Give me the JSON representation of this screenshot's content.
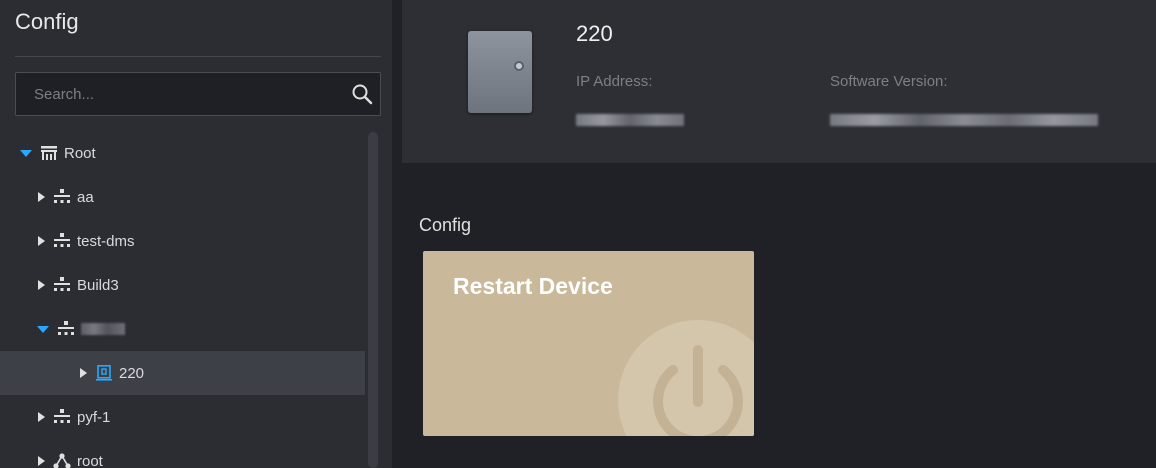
{
  "sidebar": {
    "title": "Config",
    "search": {
      "placeholder": "Search...",
      "value": ""
    },
    "tree": [
      {
        "label": "Root",
        "expanded": true,
        "icon": "root-org-icon"
      },
      {
        "label": "aa",
        "expanded": false,
        "icon": "org-unit-icon"
      },
      {
        "label": "test-dms",
        "expanded": false,
        "icon": "org-unit-icon"
      },
      {
        "label": "Build3",
        "expanded": false,
        "icon": "org-unit-icon"
      },
      {
        "label": "",
        "expanded": true,
        "icon": "org-unit-icon",
        "redacted": true
      },
      {
        "label": "220",
        "expanded": false,
        "icon": "device-icon",
        "selected": true
      },
      {
        "label": "pyf-1",
        "expanded": false,
        "icon": "org-unit-icon"
      },
      {
        "label": "root",
        "expanded": false,
        "icon": "cluster-icon"
      }
    ]
  },
  "device": {
    "name": "220",
    "ip_label": "IP Address:",
    "software_label": "Software Version:"
  },
  "config": {
    "section_title": "Config",
    "restart_card": {
      "label": "Restart Device",
      "icon": "power-icon"
    }
  },
  "colors": {
    "accent": "#2aa7ff",
    "card": "#c9b99a",
    "sidebar_bg": "#2b2d33",
    "content_bg": "#1f2126"
  }
}
